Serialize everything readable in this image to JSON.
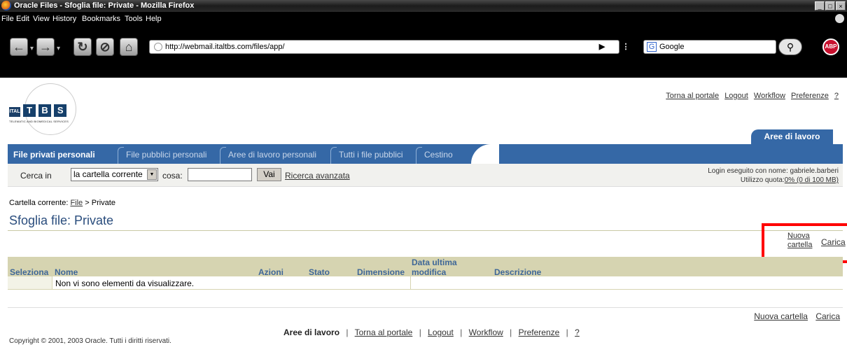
{
  "window": {
    "title": "Oracle Files - Sfoglia file: Private - Mozilla Firefox",
    "controls": [
      "_",
      "□",
      "×"
    ]
  },
  "menu": [
    "File",
    "Edit",
    "View",
    "History",
    "Bookmarks",
    "Tools",
    "Help"
  ],
  "browser": {
    "url": "http://webmail.italtbs.com/files/app/",
    "search_engine": "Google",
    "abp_label": "ABP"
  },
  "logo": {
    "prefix": "ITAL",
    "letters": [
      "T",
      "B",
      "S"
    ],
    "tagline": "TELEMATIC AND BIOMEDICAL SERVICES"
  },
  "top_links": [
    "Torna al portale",
    "Logout",
    "Workflow",
    "Preferenze",
    "?"
  ],
  "global_tab": "Aree di lavoro",
  "tabs": [
    {
      "label": "File privati personali",
      "active": true
    },
    {
      "label": "File pubblici personali",
      "active": false
    },
    {
      "label": "Aree di lavoro personali",
      "active": false
    },
    {
      "label": "Tutti i file pubblici",
      "active": false
    },
    {
      "label": "Cestino",
      "active": false
    }
  ],
  "search": {
    "label_in": "Cerca in",
    "scope_value": "la cartella corrente",
    "label_what": "cosa:",
    "query_value": "",
    "go_label": "Vai",
    "advanced_label": "Ricerca avanzata"
  },
  "login": {
    "line1": "Login eseguito con nome: gabriele.barberi",
    "quota_label": "Utilizzo quota:",
    "quota_link": "0% (0 di 100 MB)"
  },
  "breadcrumb": {
    "label": "Cartella corrente:",
    "root": "File",
    "sep": ">",
    "current": "Private"
  },
  "page_title": "Sfoglia file: Private",
  "actions": {
    "new_folder_line1": "Nuova",
    "new_folder_line2": "cartella",
    "new_folder": "Nuova cartella",
    "upload": "Carica"
  },
  "table": {
    "columns": [
      "Seleziona",
      "Nome",
      "Azioni",
      "Stato",
      "Dimensione",
      "Data ultima",
      "modifica",
      "Descrizione"
    ],
    "empty_message": "Non vi sono elementi da visualizzare."
  },
  "footer": {
    "current": "Aree di lavoro",
    "links": [
      "Torna al portale",
      "Logout",
      "Workflow",
      "Preferenze",
      "?"
    ],
    "separator": "|",
    "copyright": "Copyright © 2001, 2003 Oracle. Tutti i diritti riservati."
  },
  "colors": {
    "accent_blue": "#3568a6",
    "table_header": "#d6d4b1",
    "highlight_red": "#ff0000"
  }
}
